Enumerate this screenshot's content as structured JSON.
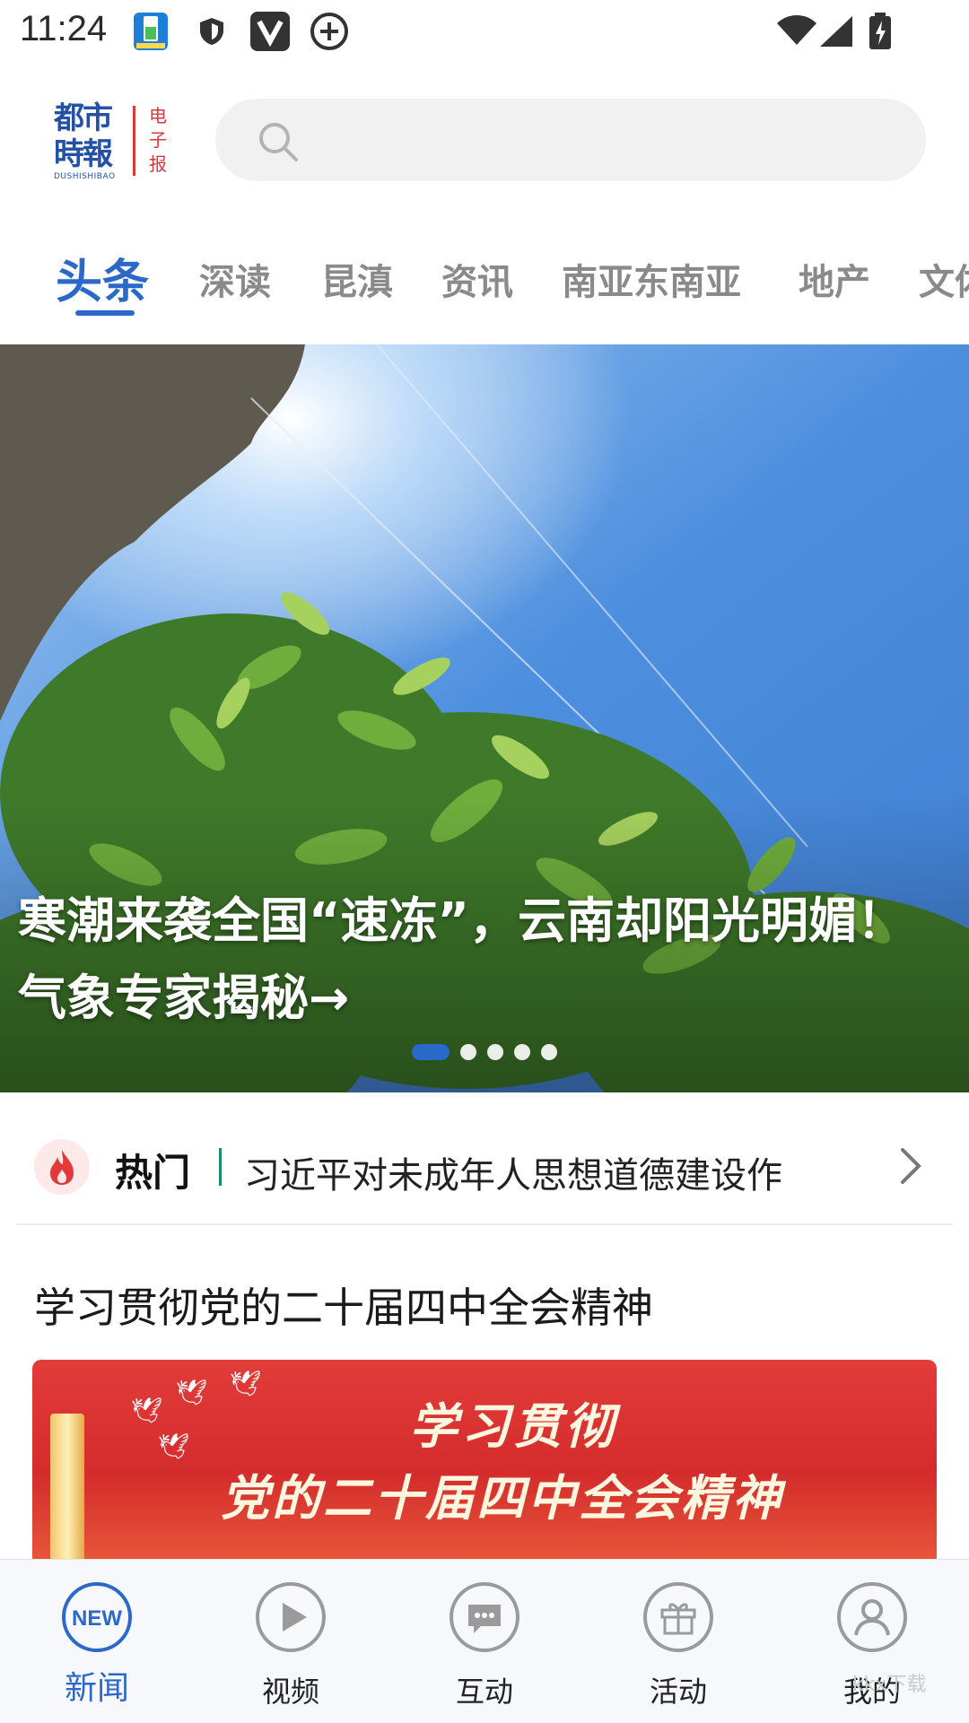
{
  "status_bar": {
    "time": "11:24",
    "icons": [
      "battery-app-icon",
      "shield-icon",
      "v-app-icon",
      "add-circle-icon",
      "wifi-icon",
      "signal-icon",
      "battery-charging-icon"
    ]
  },
  "header": {
    "logo_main": "都市時報",
    "logo_sub": "DUSHISHIBAO",
    "logo_side": "电子报",
    "search": {
      "placeholder": "",
      "value": ""
    }
  },
  "tabs": [
    "头条",
    "深读",
    "昆滇",
    "资讯",
    "南亚东南亚",
    "地产",
    "文体"
  ],
  "active_tab": 0,
  "hero": {
    "title": "寒潮来袭全国“速冻”，云南却阳光明媚！气象专家揭秘→",
    "dots": 5,
    "active_dot": 0
  },
  "hot": {
    "label": "热门",
    "text": "习近平对未成年人思想道德建设作"
  },
  "section": {
    "title": "学习贯彻党的二十届四中全会精神",
    "banner_line1": "学习贯彻",
    "banner_line2": "党的二十届四中全会精神"
  },
  "bottom_nav": [
    {
      "label": "新闻",
      "icon": "new-badge-icon",
      "active": true
    },
    {
      "label": "视频",
      "icon": "play-icon",
      "active": false
    },
    {
      "label": "互动",
      "icon": "chat-bubble-icon",
      "active": false
    },
    {
      "label": "活动",
      "icon": "gift-icon",
      "active": false
    },
    {
      "label": "我的",
      "icon": "user-icon",
      "active": false
    }
  ],
  "watermark": "kkx下载",
  "colors": {
    "accent": "#2a68c9",
    "logo_blue": "#2451a6",
    "logo_red": "#d9393b",
    "banner_red": "#d42c2c"
  }
}
